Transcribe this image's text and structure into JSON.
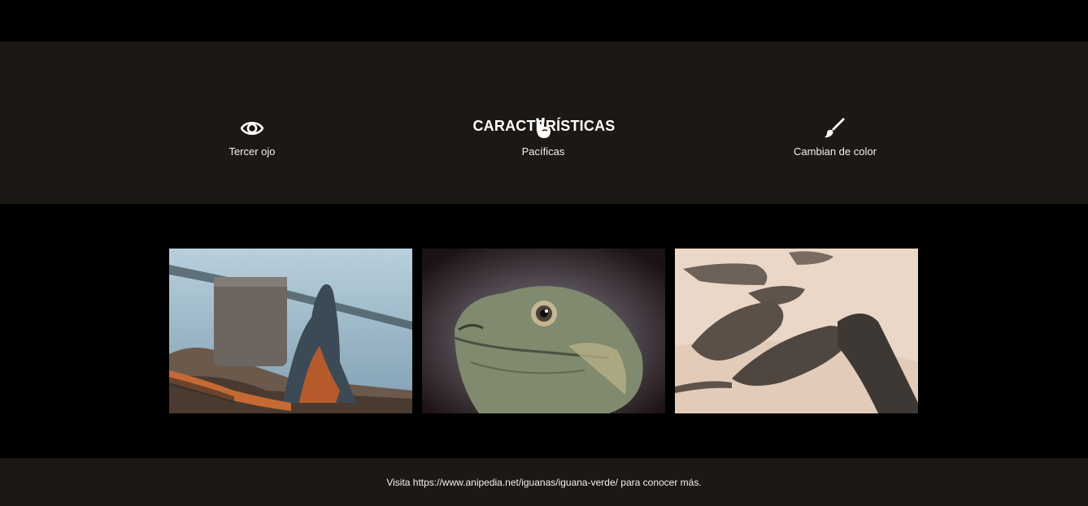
{
  "features": {
    "title": "CARACTERÍSTICAS",
    "items": [
      {
        "label": "Tercer ojo",
        "icon": "eye-icon"
      },
      {
        "label": "Pacíficas",
        "icon": "peace-hand-icon"
      },
      {
        "label": "Cambian de color",
        "icon": "paint-brush-icon"
      }
    ]
  },
  "gallery": {
    "images": [
      {
        "subject": "iguana-orange-on-rocks"
      },
      {
        "subject": "iguana-head-closeup"
      },
      {
        "subject": "iguanas-group-on-sand"
      }
    ]
  },
  "footer": {
    "text": "Visita https://www.anipedia.net/iguanas/iguana-verde/ para conocer más."
  },
  "colors": {
    "background": "#000000",
    "section_bg": "#1c1814",
    "text": "#ffffff"
  }
}
